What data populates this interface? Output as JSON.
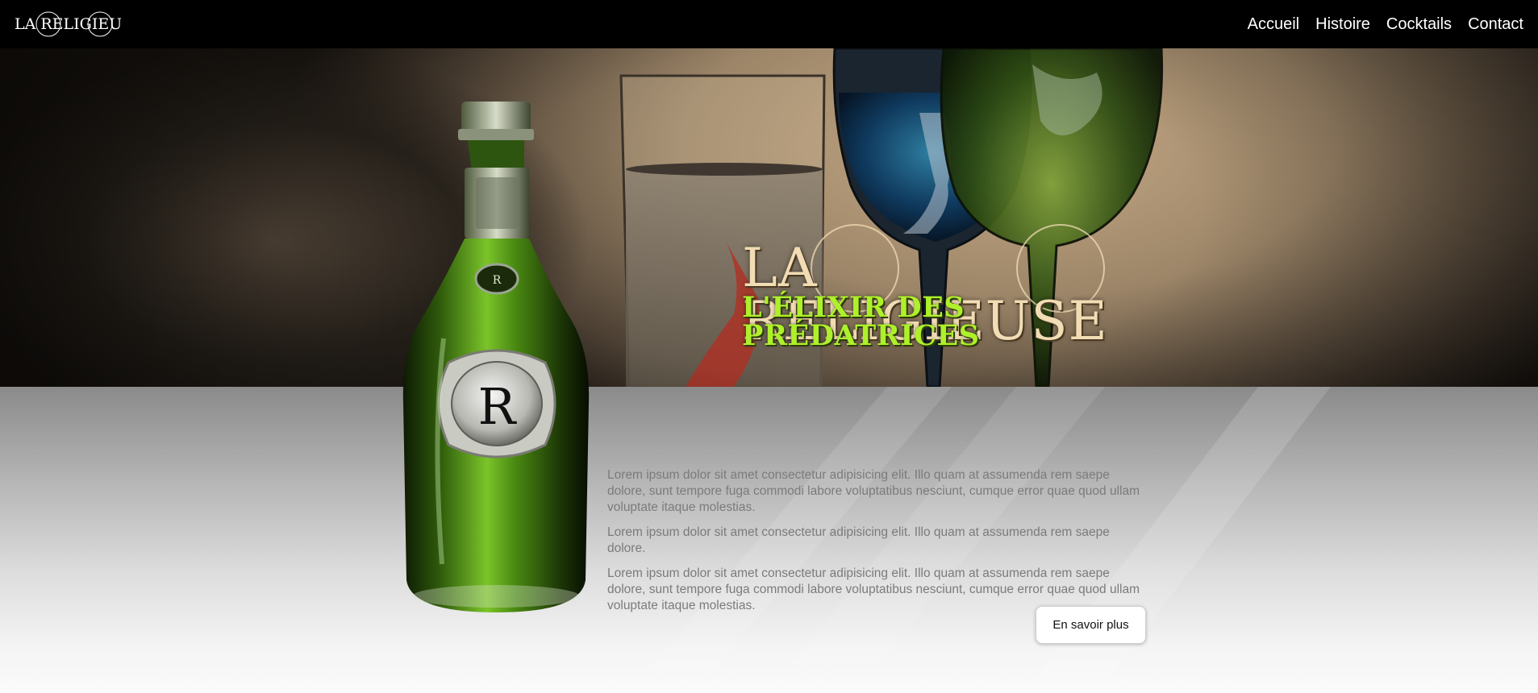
{
  "nav": {
    "logo_text": "LA RELIGIEUSE",
    "links": [
      "Accueil",
      "Histoire",
      "Cocktails",
      "Contact"
    ]
  },
  "hero": {
    "title": "LA RELIGIEUSE",
    "tagline": "L'ÉLIXIR DES PRÉDATRICES"
  },
  "content": {
    "paragraphs": [
      "Lorem ipsum dolor sit amet consectetur adipisicing elit. Illo quam at assumenda rem saepe dolore, sunt tempore fuga commodi labore voluptatibus nesciunt, cumque error quae quod ullam voluptate itaque molestias.",
      "Lorem ipsum dolor sit amet consectetur adipisicing elit. Illo quam at assumenda rem saepe dolore.",
      "Lorem ipsum dolor sit amet consectetur adipisicing elit. Illo quam at assumenda rem saepe dolore, sunt tempore fuga commodi labore voluptatibus nesciunt, cumque error quae quod ullam voluptate itaque molestias."
    ],
    "button_label": "En savoir plus"
  },
  "colors": {
    "navbar_bg": "#000000",
    "title_color": "#f1dcb4",
    "tagline_color": "#aef02a",
    "bottle_green": "#3f7a12"
  },
  "bottle": {
    "label_monogram": "R"
  }
}
